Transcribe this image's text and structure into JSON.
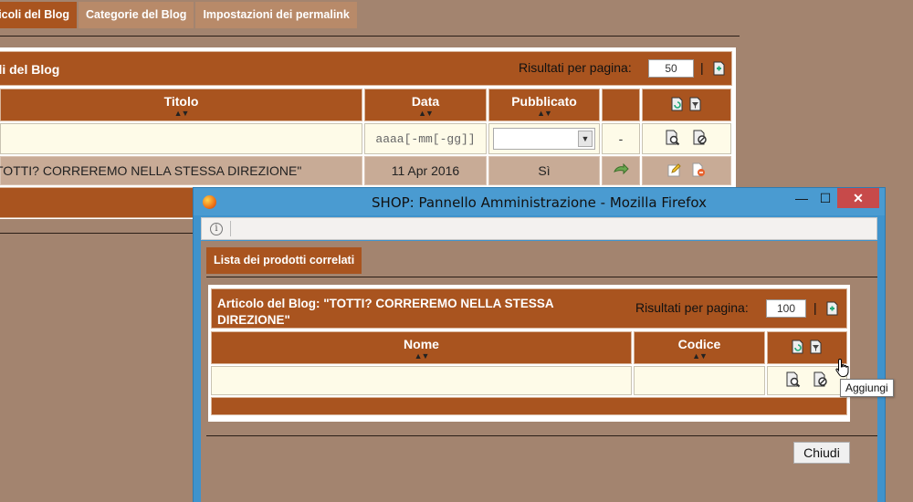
{
  "background": {
    "tabs": [
      {
        "label": "Articoli del Blog",
        "active": true
      },
      {
        "label": "Categorie del Blog",
        "active": false
      },
      {
        "label": "Impostazioni dei permalink",
        "active": false
      }
    ],
    "panel_title": "Articoli del Blog",
    "results_label": "Risultati per pagina:",
    "results_value": "50",
    "separator": "|",
    "columns": {
      "title": "Titolo",
      "date": "Data",
      "published": "Pubblicato"
    },
    "sort_glyph": "▲▼",
    "date_filter_placeholder": "aaaa[-mm[-gg]]",
    "published_filter_value": "",
    "dash": "-",
    "row": {
      "title": "TOTTI? CORREREMO NELLA STESSA DIREZIONE\"",
      "date": "11 Apr 2016",
      "published": "Sì"
    }
  },
  "window": {
    "title": "SHOP: Pannello Amministrazione - Mozilla Firefox",
    "minimize": "—",
    "maximize": "☐",
    "close": "✕",
    "info": "i"
  },
  "popup": {
    "tab_label": "Lista dei prodotti correlati",
    "panel_title": "Articolo del Blog: \"TOTTI? CORREREMO NELLA STESSA DIREZIONE\"",
    "results_label": "Risultati per pagina:",
    "results_value": "100",
    "separator": "|",
    "columns": {
      "name": "Nome",
      "code": "Codice"
    },
    "sort_glyph": "▲▼",
    "tooltip": "Aggiungi",
    "close_button": "Chiudi"
  },
  "colors": {
    "page_bg": "#a3846f",
    "header_brown": "#a9541f",
    "filter_bg": "#fefbe8",
    "window_frame": "#3f93cc",
    "close_red": "#c74a4a"
  },
  "icons": [
    "refresh-icon",
    "filter-icon",
    "search-icon",
    "clear-filter-icon",
    "link-arrow-icon",
    "edit-icon",
    "delete-icon",
    "add-icon",
    "firefox-logo-icon",
    "info-icon",
    "hand-cursor-icon"
  ]
}
